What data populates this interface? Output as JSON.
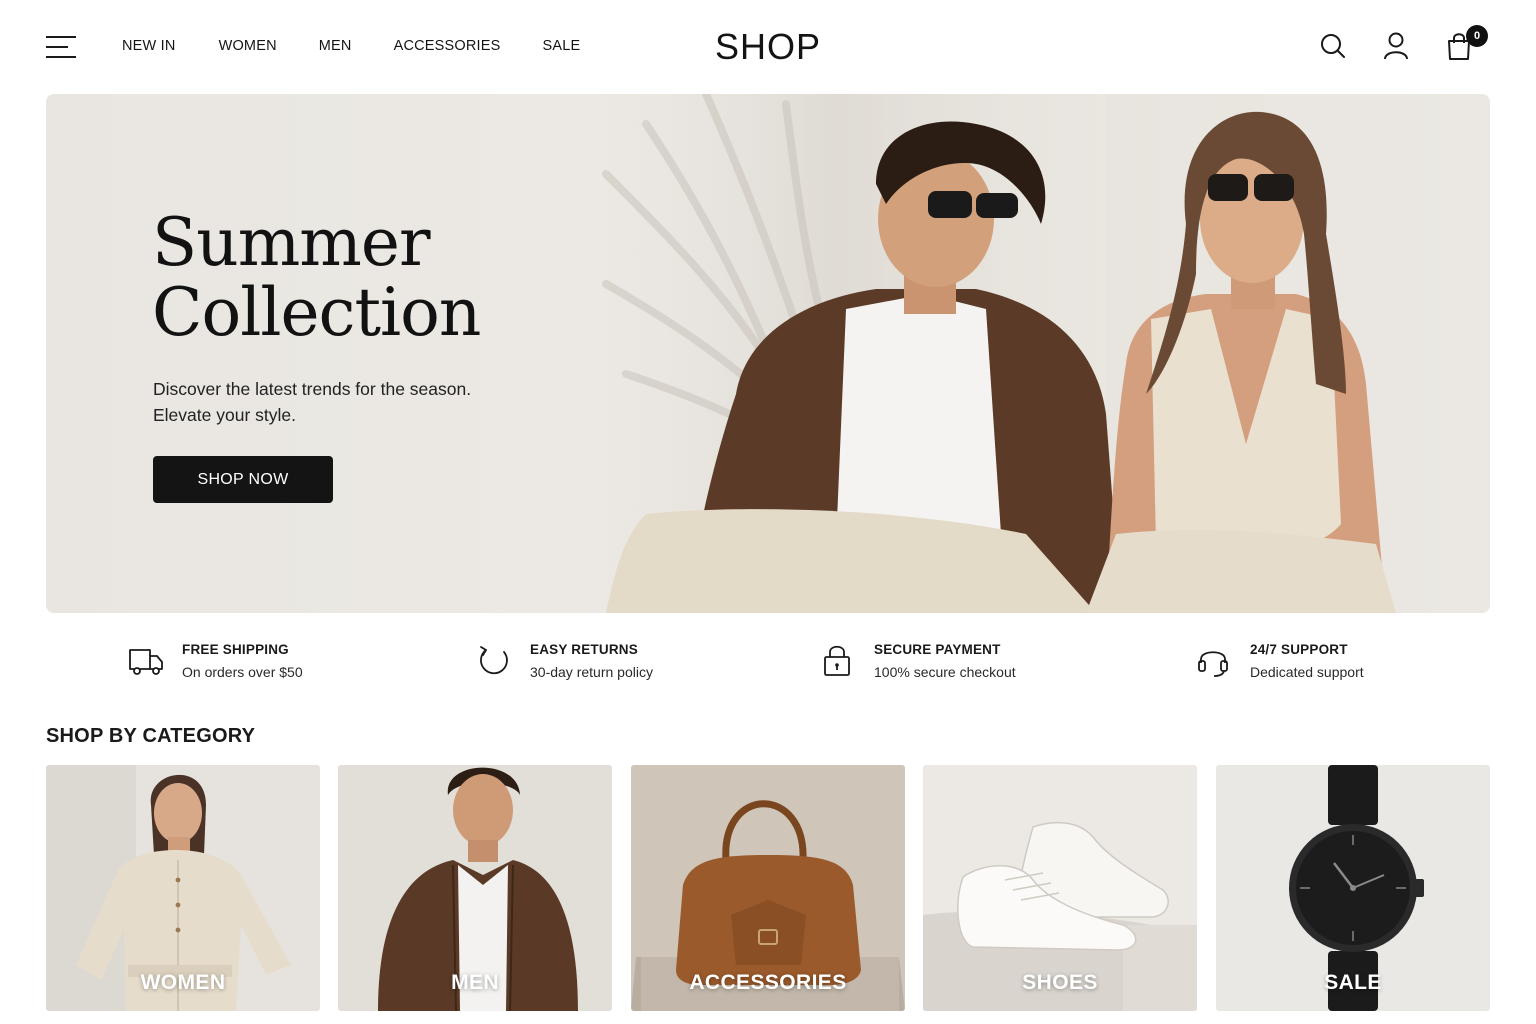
{
  "header": {
    "menu_icon": "hamburger-menu-icon",
    "nav": [
      "NEW IN",
      "WOMEN",
      "MEN",
      "ACCESSORIES",
      "SALE"
    ],
    "logo": "SHOP",
    "icons": [
      "search-icon",
      "user-icon",
      "shopping-bag-icon"
    ],
    "cart_count": "0"
  },
  "hero": {
    "title_line1": "Summer",
    "title_line2": "Collection",
    "subtitle_line1": "Discover the latest trends for the season.",
    "subtitle_line2": "Elevate your style.",
    "cta": "SHOP NOW"
  },
  "features": [
    {
      "icon": "delivery-truck-icon",
      "title": "FREE SHIPPING",
      "subtitle": "On orders over $50"
    },
    {
      "icon": "refresh-icon",
      "title": "EASY RETURNS",
      "subtitle": "30-day return policy"
    },
    {
      "icon": "lock-icon",
      "title": "SECURE PAYMENT",
      "subtitle": "100% secure checkout"
    },
    {
      "icon": "headset-icon",
      "title": "24/7 SUPPORT",
      "subtitle": "Dedicated support"
    }
  ],
  "categories": {
    "heading": "SHOP BY CATEGORY",
    "items": [
      {
        "label": "WOMEN"
      },
      {
        "label": "MEN"
      },
      {
        "label": "ACCESSORIES"
      },
      {
        "label": "SHOES"
      },
      {
        "label": "SALE"
      }
    ]
  },
  "colors": {
    "text": "#141414",
    "button": "#141414",
    "hero_background": "#eae7e2",
    "brown": "#5a3a26",
    "cream": "#e6dccb"
  }
}
